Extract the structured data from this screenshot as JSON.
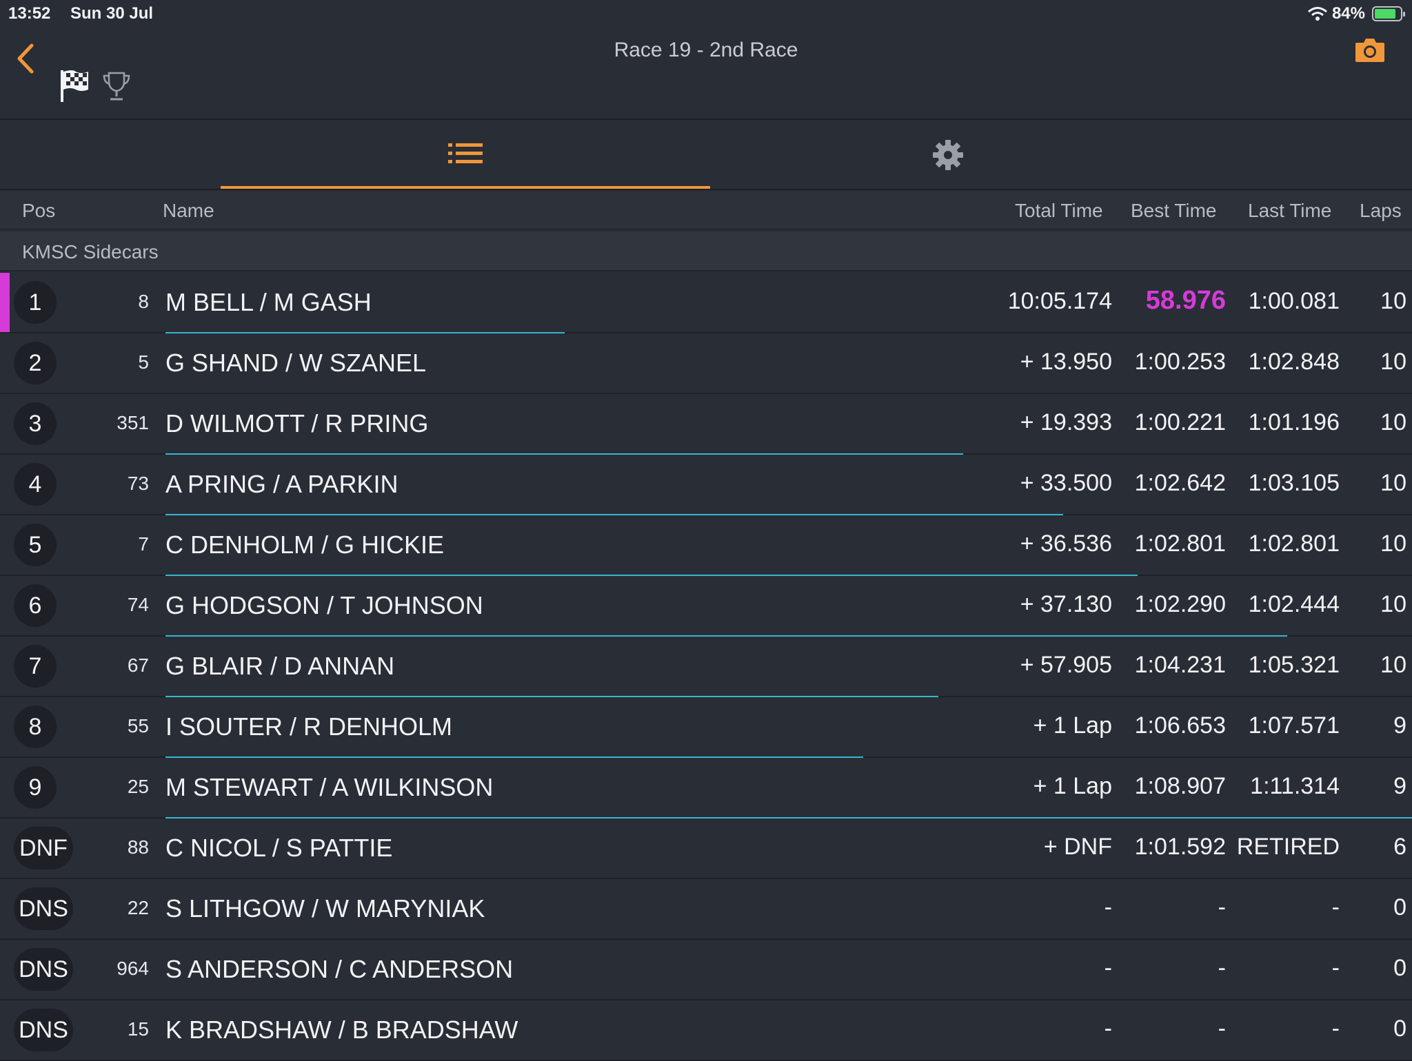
{
  "status": {
    "time": "13:52",
    "date": "Sun 30 Jul",
    "battery": "84%",
    "battery_level": 0.84
  },
  "nav": {
    "title": "Race 19 - 2nd Race"
  },
  "columns": {
    "pos": "Pos",
    "name": "Name",
    "total": "Total Time",
    "best": "Best Time",
    "last": "Last Time",
    "laps": "Laps"
  },
  "group": {
    "name": "KMSC Sidecars"
  },
  "colors": {
    "accent": "#f0973a",
    "fastest": "#d63bd8",
    "progress": "#38b6cc"
  },
  "results": [
    {
      "pos": "1",
      "no": "8",
      "name": "M BELL / M GASH",
      "total": "10:05.174",
      "best": "58.976",
      "last": "1:00.081",
      "laps": "10",
      "fastest": true,
      "progress": 0.32
    },
    {
      "pos": "2",
      "no": "5",
      "name": "G SHAND / W SZANEL",
      "total": "+ 13.950",
      "best": "1:00.253",
      "last": "1:02.848",
      "laps": "10",
      "progress": 0
    },
    {
      "pos": "3",
      "no": "351",
      "name": "D WILMOTT / R PRING",
      "total": "+ 19.393",
      "best": "1:00.221",
      "last": "1:01.196",
      "laps": "10",
      "progress": 0.64
    },
    {
      "pos": "4",
      "no": "73",
      "name": "A PRING / A PARKIN",
      "total": "+ 33.500",
      "best": "1:02.642",
      "last": "1:03.105",
      "laps": "10",
      "progress": 0.72
    },
    {
      "pos": "5",
      "no": "7",
      "name": "C DENHOLM / G HICKIE",
      "total": "+ 36.536",
      "best": "1:02.801",
      "last": "1:02.801",
      "laps": "10",
      "progress": 0.78
    },
    {
      "pos": "6",
      "no": "74",
      "name": "G HODGSON / T JOHNSON",
      "total": "+ 37.130",
      "best": "1:02.290",
      "last": "1:02.444",
      "laps": "10",
      "progress": 0.9
    },
    {
      "pos": "7",
      "no": "67",
      "name": "G BLAIR / D ANNAN",
      "total": "+ 57.905",
      "best": "1:04.231",
      "last": "1:05.321",
      "laps": "10",
      "progress": 0.62
    },
    {
      "pos": "8",
      "no": "55",
      "name": "I SOUTER / R DENHOLM",
      "total": "+ 1 Lap",
      "best": "1:06.653",
      "last": "1:07.571",
      "laps": "9",
      "progress": 0.56
    },
    {
      "pos": "9",
      "no": "25",
      "name": "M STEWART / A WILKINSON",
      "total": "+ 1 Lap",
      "best": "1:08.907",
      "last": "1:11.314",
      "laps": "9",
      "progress": 1.0
    },
    {
      "pos": "DNF",
      "no": "88",
      "name": "C NICOL / S PATTIE",
      "total": "+ DNF",
      "best": "1:01.592",
      "last": "RETIRED",
      "laps": "6",
      "progress": 0
    },
    {
      "pos": "DNS",
      "no": "22",
      "name": "S LITHGOW / W MARYNIAK",
      "total": "-",
      "best": "-",
      "last": "-",
      "laps": "0",
      "progress": 0
    },
    {
      "pos": "DNS",
      "no": "964",
      "name": "S ANDERSON /  C ANDERSON",
      "total": "-",
      "best": "-",
      "last": "-",
      "laps": "0",
      "progress": 0
    },
    {
      "pos": "DNS",
      "no": "15",
      "name": "K BRADSHAW / B BRADSHAW",
      "total": "-",
      "best": "-",
      "last": "-",
      "laps": "0",
      "progress": 0
    }
  ]
}
